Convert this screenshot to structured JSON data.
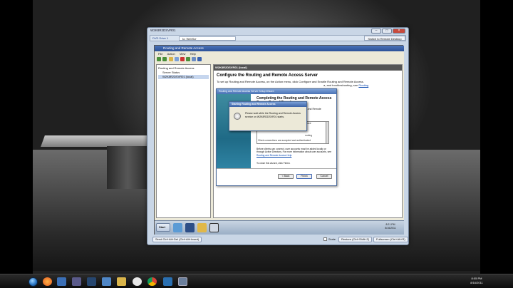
{
  "vm": {
    "title": "W2K8R2DSVR01",
    "menu_label": "DVD Drive 1",
    "tab_label": "to: WebSvr",
    "switch_label": "Switch to Remote Desktop"
  },
  "mmc": {
    "title": "Routing and Remote Access",
    "menu": [
      "File",
      "Action",
      "View",
      "Help"
    ],
    "tree": [
      "Routing and Remote Access",
      "Server Status",
      "W2K8R2DSVR01 (local)"
    ],
    "detail_header": "W2K8R2DSVR01 (local)",
    "heading": "Configure the Routing and Remote Access Server",
    "body": "To set up Routing and Remote Access, on the Action menu, click Configure and Enable Routing and Remote Access.",
    "body2": "a, and troubleshooting, see",
    "link": "Routing"
  },
  "wizard": {
    "title": "Routing and Remote Access Server Setup Wizard",
    "heading": "Completing the Routing and Remote Access Server Setup Wizard",
    "frag1": "ing and Remote",
    "list_line1": "interface",
    "list_line2": "routing",
    "list_line3": "Client connections are accepted and authenticated",
    "note": "Before clients can connect, user accounts must be added locally or through Active Directory. For more information about user accounts, see",
    "note_link": "Routing and Remote Access Help",
    "close_text": "To close this wizard, click Finish.",
    "back": "< Back",
    "finish": "Finish",
    "cancel": "Cancel"
  },
  "progress": {
    "title": "Starting Routing and Remote Access",
    "text": "Please wait while the Routing and Remote Access service on W2K8R2DSVR01 starts.",
    "icon": "hourglass-icon"
  },
  "guest_taskbar": {
    "start": "Start",
    "clock_time": "8:21 PM",
    "clock_date": "8/16/2011"
  },
  "vm_status": {
    "cad": "Send Ctrl+Alt+Del (Ctrl+Alt+Insert)",
    "scale": "Scale",
    "restore": "Restore (Ctrl+Shift+Z)",
    "fullscreen": "Fullscreen (Ctrl+Alt+R)"
  },
  "host_taskbar": {
    "clock_time": "8:05 PM",
    "clock_date": "8/16/2011",
    "icons": [
      "firefox-icon",
      "media-player-icon",
      "link-icon",
      "x-icon",
      "dropbox-icon",
      "folder-icon",
      "apple-icon",
      "chrome-icon",
      "xsplit-icon",
      "vm-icon"
    ]
  }
}
